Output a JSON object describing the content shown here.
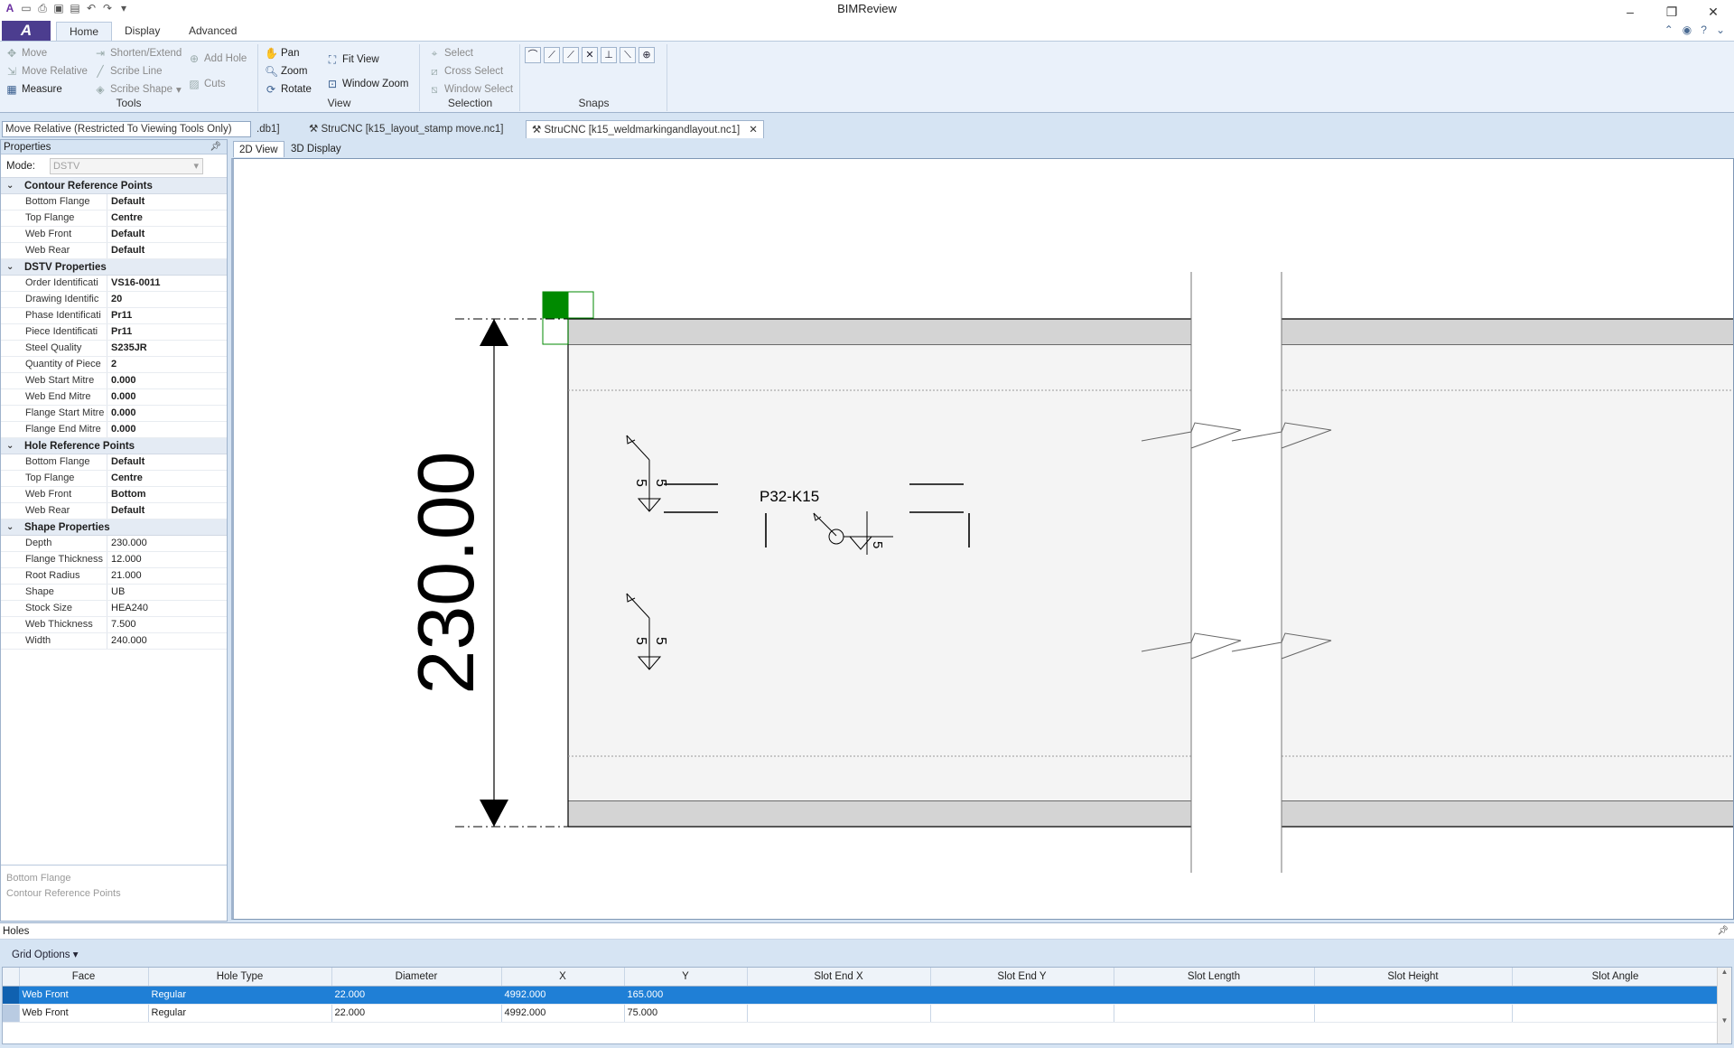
{
  "app": {
    "title": "BIMReview"
  },
  "ribbon": {
    "tabs": [
      "Home",
      "Display",
      "Advanced"
    ],
    "tools": {
      "label": "Tools",
      "move": "Move",
      "move_relative": "Move Relative",
      "measure": "Measure",
      "shorten_extend": "Shorten/Extend",
      "scribe_line": "Scribe Line",
      "scribe_shape": "Scribe Shape",
      "add_hole": "Add Hole",
      "cuts": "Cuts"
    },
    "view": {
      "label": "View",
      "pan": "Pan",
      "zoom": "Zoom",
      "rotate": "Rotate",
      "fit_view": "Fit View",
      "window_zoom": "Window Zoom"
    },
    "selection": {
      "label": "Selection",
      "select": "Select",
      "cross_select": "Cross Select",
      "window_select": "Window Select"
    },
    "snaps": {
      "label": "Snaps"
    }
  },
  "status": {
    "text": "Move Relative (Restricted To Viewing Tools Only)"
  },
  "doc_tabs": [
    ".db1]",
    "StruCNC [k15_layout_stamp move.nc1]",
    "StruCNC [k15_weldmarkingandlayout.nc1]"
  ],
  "view_tabs": [
    "2D View",
    "3D Display"
  ],
  "properties": {
    "title": "Properties",
    "mode_label": "Mode:",
    "mode_value": "DSTV",
    "categories": [
      {
        "name": "Contour Reference Points",
        "rows": [
          [
            "Bottom Flange",
            "Default"
          ],
          [
            "Top Flange",
            "Centre"
          ],
          [
            "Web Front",
            "Default"
          ],
          [
            "Web Rear",
            "Default"
          ]
        ]
      },
      {
        "name": "DSTV Properties",
        "rows": [
          [
            "Order Identificati",
            "VS16-0011"
          ],
          [
            "Drawing Identific",
            "20"
          ],
          [
            "Phase Identificati",
            "Pr11"
          ],
          [
            "Piece Identificati",
            "Pr11"
          ],
          [
            "Steel Quality",
            "S235JR"
          ],
          [
            "Quantity of Piece",
            "2"
          ],
          [
            "Web Start Mitre",
            "0.000"
          ],
          [
            "Web End Mitre",
            "0.000"
          ],
          [
            "Flange Start Mitre",
            "0.000"
          ],
          [
            "Flange End Mitre",
            "0.000"
          ]
        ]
      },
      {
        "name": "Hole Reference Points",
        "rows": [
          [
            "Bottom Flange",
            "Default"
          ],
          [
            "Top Flange",
            "Centre"
          ],
          [
            "Web Front",
            "Bottom"
          ],
          [
            "Web Rear",
            "Default"
          ]
        ]
      },
      {
        "name": "Shape Properties",
        "rows": [
          [
            "Depth",
            "230.000"
          ],
          [
            "Flange Thickness",
            "12.000"
          ],
          [
            "Root Radius",
            "21.000"
          ],
          [
            "Shape",
            "UB"
          ],
          [
            "Stock Size",
            "HEA240"
          ],
          [
            "Web Thickness",
            "7.500"
          ],
          [
            "Width",
            "240.000"
          ]
        ]
      }
    ],
    "description": {
      "title": "Bottom Flange",
      "subtitle": "Contour Reference Points"
    }
  },
  "drawing": {
    "dimension": "230.00",
    "part_mark": "P32-K15",
    "weld_label": "5",
    "colors": {
      "marker": "#008a00",
      "flange": "#d4d4d4",
      "web": "#f4f4f4"
    }
  },
  "holes": {
    "title": "Holes",
    "grid_options": "Grid Options",
    "columns": [
      "Face",
      "Hole Type",
      "Diameter",
      "X",
      "Y",
      "Slot End X",
      "Slot End Y",
      "Slot Length",
      "Slot Height",
      "Slot Angle"
    ],
    "rows": [
      [
        "Web Front",
        "Regular",
        "22.000",
        "4992.000",
        "165.000",
        "",
        "",
        "",
        "",
        ""
      ],
      [
        "Web Front",
        "Regular",
        "22.000",
        "4992.000",
        "75.000",
        "",
        "",
        "",
        "",
        ""
      ]
    ]
  }
}
